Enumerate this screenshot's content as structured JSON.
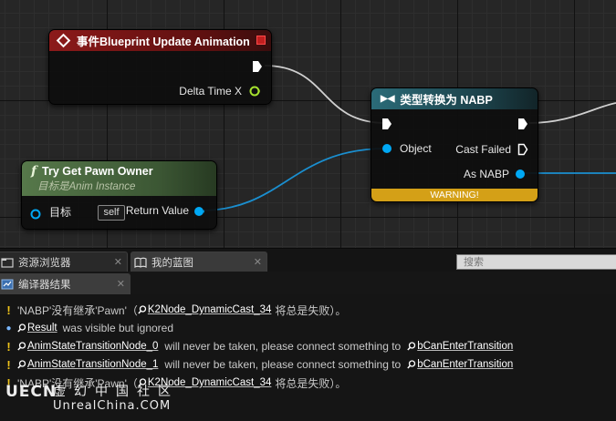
{
  "graph": {
    "event_node": {
      "title": "事件Blueprint Update Animation",
      "pin_delta": "Delta Time X"
    },
    "cast_node": {
      "title": "类型转换为 NABP",
      "pin_object": "Object",
      "pin_cast_failed": "Cast Failed",
      "pin_as": "As NABP",
      "warning": "WARNING!"
    },
    "func_node": {
      "title": "Try Get Pawn Owner",
      "subtitle": "目标是Anim Instance",
      "pin_target": "目标",
      "self_value": "self",
      "pin_return": "Return Value"
    }
  },
  "panel": {
    "tabs": [
      {
        "label": "资源浏览器",
        "icon": "content-browser-icon"
      },
      {
        "label": "我的蓝图",
        "icon": "book-icon"
      }
    ],
    "search_placeholder": "搜索",
    "compiler_tab": {
      "label": "编译器结果",
      "icon": "compiler-icon"
    },
    "log": [
      {
        "severity": "warning",
        "pre": "'NABP'没有继承'Pawn'（",
        "link1": "K2Node_DynamicCast_34",
        "mid": "将总是失败）。",
        "link2": "",
        "post": ""
      },
      {
        "severity": "info",
        "pre": "",
        "link1": "Result",
        "mid": "was visible but ignored",
        "link2": "",
        "post": ""
      },
      {
        "severity": "warning",
        "pre": "",
        "link1": "AnimStateTransitionNode_0",
        "mid": "will never be taken, please connect something to",
        "link2": "bCanEnterTransition",
        "post": ""
      },
      {
        "severity": "warning",
        "pre": "",
        "link1": "AnimStateTransitionNode_1",
        "mid": "will never be taken, please connect something to",
        "link2": "bCanEnterTransition",
        "post": ""
      },
      {
        "severity": "warning",
        "pre": "'NABP'没有继承'Pawn'（",
        "link1": "K2Node_DynamicCast_34",
        "mid": "将总是失败）。",
        "link2": "",
        "post": ""
      }
    ]
  },
  "watermark": {
    "logo": "UECN",
    "name": "虚幻中国社区",
    "url": "UnrealChina.COM"
  },
  "colors": {
    "event_header": "#8c1a1a",
    "cast_header": "#2b6b78",
    "func_header": "#56784a",
    "object_pin": "#00a8f4",
    "warning": "#d4a017",
    "wire_exec": "#d8d8d8",
    "wire_object": "#1a8fd0"
  }
}
